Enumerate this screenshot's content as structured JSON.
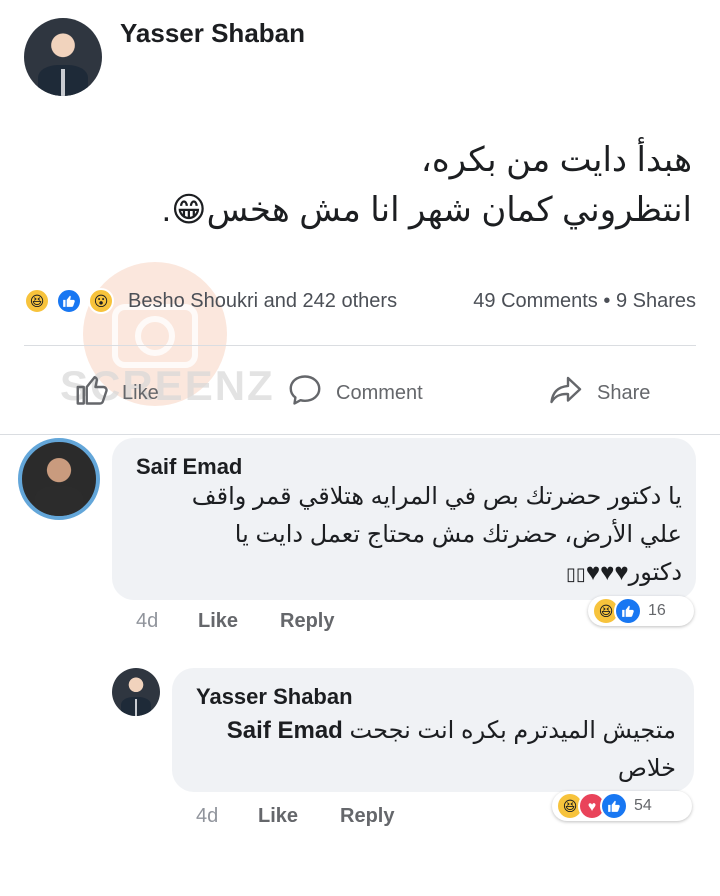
{
  "post": {
    "author": "Yasser Shaban",
    "text_line1": "هبدأ دايت من بكره،",
    "text_line2": "انتظروني كمان شهر انا مش هخس",
    "emoji": "😁",
    "trailing": ".",
    "reactions_text": "Besho Shoukri and 242 others",
    "comments_count": "49 Comments",
    "separator": "•",
    "shares_count": "9 Shares"
  },
  "actions": {
    "like": "Like",
    "comment": "Comment",
    "share": "Share"
  },
  "watermark": {
    "text": "SCREENZ"
  },
  "comments": [
    {
      "author": "Saif Emad",
      "line1": "يا دكتور حضرتك بص في المرايه هتلاقي قمر واقف",
      "line2": "علي الأرض، حضرتك مش محتاج تعمل دايت يا",
      "line3": "دكتور♥♥♥",
      "trailing_glyphs": "▯▯",
      "time": "4d",
      "like": "Like",
      "reply": "Reply",
      "reaction_count": "16"
    },
    {
      "author": "Yasser Shaban",
      "mention": "Saif Emad",
      "line1": "متجيش الميدترم بكره انت نجحت",
      "line2": "خلاص",
      "time": "4d",
      "like": "Like",
      "reply": "Reply",
      "reaction_count": "54"
    }
  ],
  "icons": {
    "haha": "haha-reaction-icon",
    "like": "like-reaction-icon",
    "wow": "wow-reaction-icon",
    "love": "love-reaction-icon"
  },
  "colors": {
    "like_blue": "#1877f2",
    "love_red": "#e9435a",
    "haha_yellow": "#f7c33c",
    "bubble_gray": "#f0f2f5",
    "meta_gray": "#65676b"
  }
}
